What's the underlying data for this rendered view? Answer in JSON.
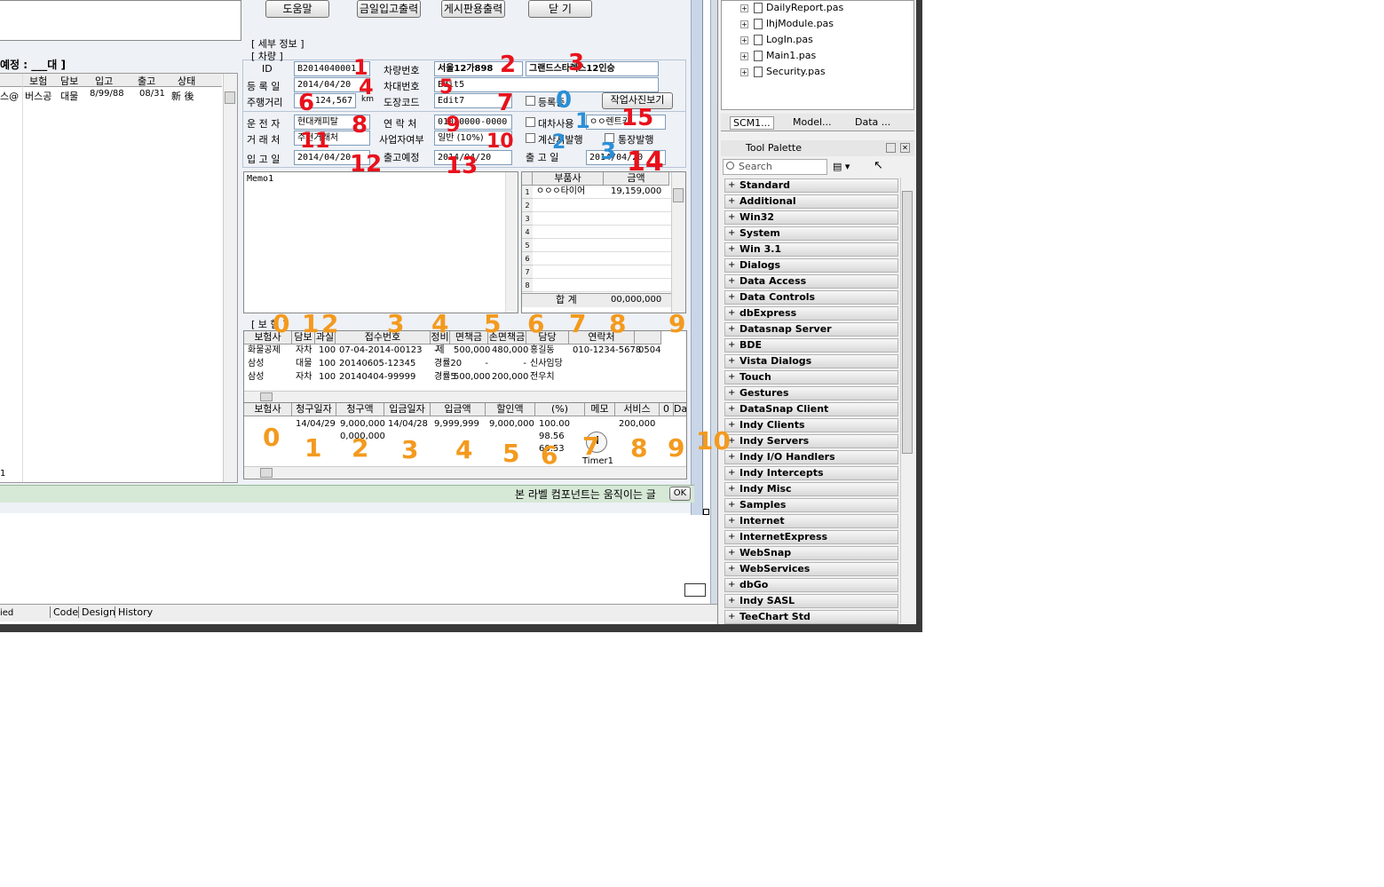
{
  "buttons": {
    "help": "도움말",
    "daily_io_print": "금일입고출력",
    "board_print": "게시판용출력",
    "close": "닫 기",
    "photo_view": "작업사진보기",
    "ok": "OK"
  },
  "left_panel": {
    "expected_label": "예정 : ___대 ]",
    "columns": [
      "보험",
      "담보",
      "입고",
      "출고",
      "상태"
    ],
    "row": [
      "스@",
      "버스공",
      "대물",
      "8/99/88",
      "08/31",
      "新 後"
    ],
    "footer_digit": "1"
  },
  "detail": {
    "section_title": "[ 세부 정보 ]",
    "vehicle_title": "[ 차량 ]",
    "id_label": "ID",
    "id_value": "B2014040001",
    "plate_label": "차량번호",
    "plate_value": "서울12가898",
    "model_value": "그랜드스타렉스12인승",
    "reg_date_label": "등 록 일",
    "reg_date_value": "2014/04/20",
    "chassis_label": "차대번호",
    "chassis_value": "Edit5",
    "mileage_label": "주행거리",
    "mileage_value": "124,567",
    "mileage_unit": "km",
    "paint_label": "도장코드",
    "paint_value": "Edit7",
    "reg_check_label": "등록증",
    "driver_label": "운 전 자",
    "driver_value": "현대캐피탈",
    "contact_label": "연 락 처",
    "contact_value": "010-0000-0000",
    "rental_label": "대차사용",
    "rental_value": "ㅇㅇ렌트카",
    "client_label": "거 래 처",
    "client_value": "주현거래처",
    "biz_label": "사업자여부",
    "biz_value": "일반 (10%)",
    "invoice_label": "계산서발행",
    "cash_label": "통장발행",
    "in_date_label": "입 고 일",
    "in_date_value": "2014/04/20",
    "planned_out_label": "출고예정",
    "planned_out_value": "2014/04/20",
    "out_date_label": "출 고 일",
    "out_date_value": "2014/04/20",
    "memo": "Memo1"
  },
  "parts": {
    "columns": [
      "부품사",
      "금액"
    ],
    "rows": [
      [
        "ㅇㅇㅇ타이어",
        "19,159,000"
      ],
      [
        "",
        ""
      ],
      [
        "",
        ""
      ],
      [
        "",
        ""
      ],
      [
        "",
        ""
      ],
      [
        "",
        ""
      ],
      [
        "",
        ""
      ],
      [
        "",
        ""
      ]
    ],
    "total_label": "합 계",
    "total_value": "00,000,000"
  },
  "insurance": {
    "title": "[ 보 험 ]",
    "columns": [
      "보험사",
      "담보",
      "과실",
      "접수번호",
      "정비제",
      "면책금",
      "손면책금",
      "담당",
      "연락처",
      ""
    ],
    "rows": [
      [
        "화물공제",
        "자차",
        "100",
        "07-04-2014-00123",
        "–",
        "500,000",
        "480,000",
        "홍길동",
        "010-1234-5678",
        "0504"
      ],
      [
        "삼성",
        "대물",
        "100",
        "20140605-12345",
        "경률20",
        "-",
        "-",
        "신사임당",
        "",
        ""
      ],
      [
        "삼성",
        "자차",
        "100",
        "20140404-99999",
        "경률5",
        "500,000",
        "200,000",
        "전우치",
        "",
        ""
      ]
    ]
  },
  "claims": {
    "columns": [
      "보험사",
      "청구일자",
      "청구액",
      "입금일자",
      "입금액",
      "할인액",
      "(%)",
      "메모",
      "서비스",
      "0",
      "Dat"
    ],
    "rows": [
      [
        "",
        "14/04/29",
        "9,000,000",
        "14/04/28",
        "9,999,999",
        "9,000,000",
        "100.00",
        "",
        "200,000"
      ],
      [
        "",
        "",
        "0,000,000",
        "",
        "",
        "",
        "98.56",
        "",
        ""
      ],
      [
        "",
        "",
        "",
        "",
        "",
        "",
        "60.53",
        "",
        ""
      ]
    ],
    "timer_label": "Timer1"
  },
  "status_bar": {
    "text": "본 라벨 컴포넌트는 움직이는 글"
  },
  "bottom_tabs": {
    "left_fragment": "ied",
    "code": "Code",
    "design": "Design",
    "history": "History"
  },
  "project_tree": [
    "DailyReport.pas",
    "lhjModule.pas",
    "LogIn.pas",
    "Main1.pas",
    "Security.pas"
  ],
  "side_tabs": [
    "SCM1...",
    "Model...",
    "Data ..."
  ],
  "tool_palette": {
    "title": "Tool Palette",
    "search_placeholder": "Search",
    "items": [
      "Standard",
      "Additional",
      "Win32",
      "System",
      "Win 3.1",
      "Dialogs",
      "Data Access",
      "Data Controls",
      "dbExpress",
      "Datasnap Server",
      "BDE",
      "Vista Dialogs",
      "Touch",
      "Gestures",
      "DataSnap Client",
      "Indy Clients",
      "Indy Servers",
      "Indy I/O Handlers",
      "Indy Intercepts",
      "Indy Misc",
      "Samples",
      "Internet",
      "InternetExpress",
      "WebSnap",
      "WebServices",
      "dbGo",
      "Indy SASL",
      "TeeChart Std"
    ]
  },
  "annotations": {
    "red_1": "1",
    "red_2": "2",
    "red_3": "3",
    "red_4": "4",
    "red_5": "5",
    "red_6": "6",
    "red_7": "7",
    "red_8": "8",
    "red_9": "9",
    "red_10": "10",
    "red_11": "11",
    "red_12": "12",
    "red_13": "13",
    "red_14": "14",
    "red_15": "15",
    "blue_10": "0",
    "blue_1": "1",
    "blue_2": "2",
    "blue_3": "3",
    "ins_0": "0",
    "ins_1": "1",
    "ins_2": "2",
    "ins_3": "3",
    "ins_4": "4",
    "ins_5": "5",
    "ins_6": "6",
    "ins_7": "7",
    "ins_8": "8",
    "ins_9": "9",
    "cl_0": "0",
    "cl_1": "1",
    "cl_2": "2",
    "cl_3": "3",
    "cl_4": "4",
    "cl_5": "5",
    "cl_6": "6",
    "cl_7": "7",
    "cl_8": "8",
    "cl_9": "9",
    "cl_10": "10",
    "colors": {
      "red": "#e8121c",
      "orange": "#f39a1e",
      "blue": "#2b8fd6"
    }
  }
}
